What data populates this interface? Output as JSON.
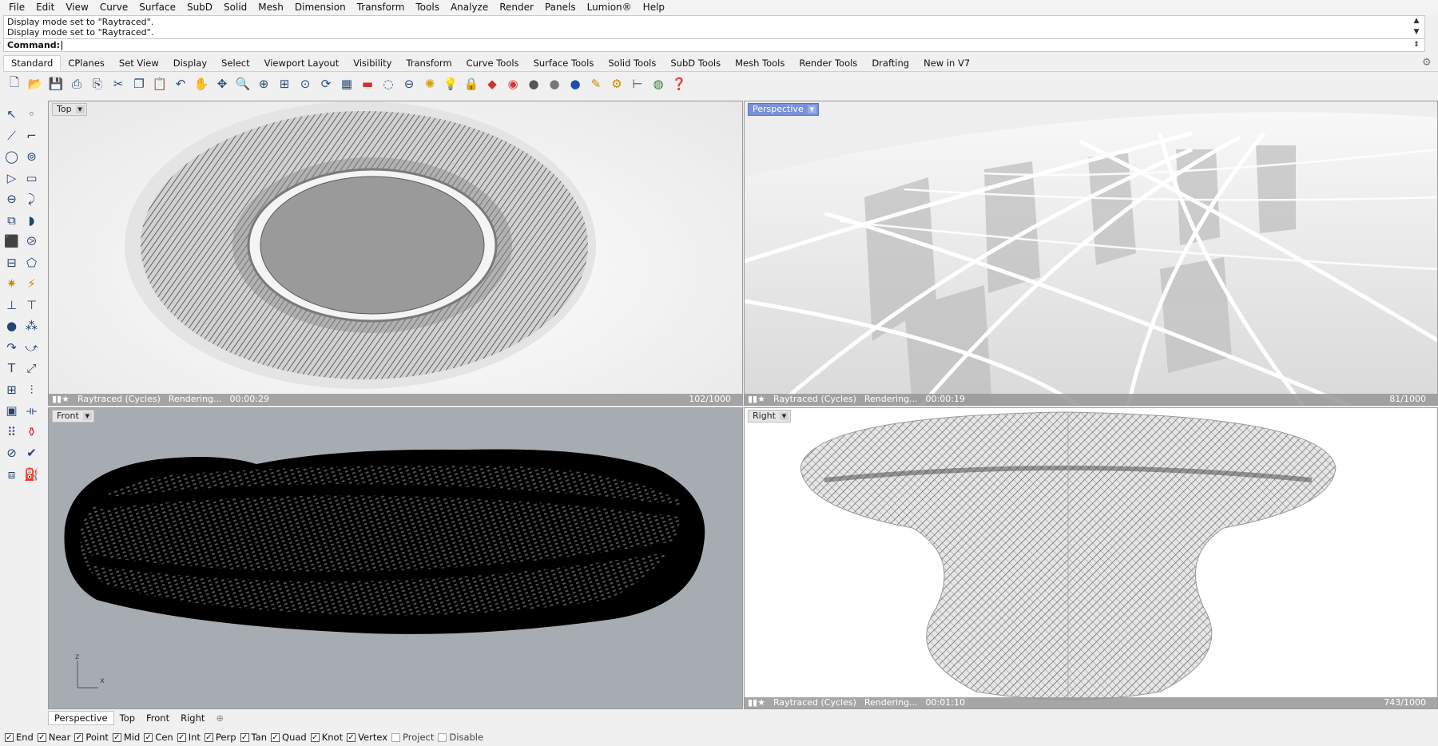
{
  "menu": [
    "File",
    "Edit",
    "View",
    "Curve",
    "Surface",
    "SubD",
    "Solid",
    "Mesh",
    "Dimension",
    "Transform",
    "Tools",
    "Analyze",
    "Render",
    "Panels",
    "Lumion®",
    "Help"
  ],
  "history": [
    "Display mode set to \"Raytraced\".",
    "Display mode set to \"Raytraced\"."
  ],
  "command": {
    "label": "Command:"
  },
  "tabs": [
    {
      "label": "Standard",
      "active": true
    },
    {
      "label": "CPlanes"
    },
    {
      "label": "Set View"
    },
    {
      "label": "Display"
    },
    {
      "label": "Select"
    },
    {
      "label": "Viewport Layout"
    },
    {
      "label": "Visibility"
    },
    {
      "label": "Transform"
    },
    {
      "label": "Curve Tools"
    },
    {
      "label": "Surface Tools"
    },
    {
      "label": "Solid Tools"
    },
    {
      "label": "SubD Tools"
    },
    {
      "label": "Mesh Tools"
    },
    {
      "label": "Render Tools"
    },
    {
      "label": "Drafting"
    },
    {
      "label": "New in V7"
    }
  ],
  "toolbar_icons": [
    "new-file",
    "open-folder",
    "save",
    "print",
    "import",
    "cut",
    "copy",
    "paste",
    "undo",
    "pan",
    "rotate-view",
    "zoom",
    "zoom-window",
    "zoom-extents",
    "zoom-selected",
    "regen",
    "grid",
    "car-model",
    "render-preview",
    "world-axes",
    "snap",
    "lightbulb",
    "lock",
    "layer",
    "color-wheel",
    "sphere-shaded",
    "sphere-rendered",
    "sphere-blue",
    "pencil",
    "gears",
    "grid-dimension",
    "earth",
    "help"
  ],
  "left_tools": [
    [
      "select-arrow",
      "point"
    ],
    [
      "polyline",
      "curve-cp"
    ],
    [
      "circle",
      "ellipse"
    ],
    [
      "polygon",
      "rectangle"
    ],
    [
      "arc",
      "fillet-curve"
    ],
    [
      "surface-edit",
      "surface-loft"
    ],
    [
      "box",
      "boolean"
    ],
    [
      "extrude",
      "plane"
    ],
    [
      "explode",
      "blend"
    ],
    [
      "array",
      "mirror"
    ],
    [
      "sphere-fill",
      "cluster"
    ],
    [
      "rotate",
      "move-arc"
    ],
    [
      "text",
      "dimension"
    ],
    [
      "group",
      "align"
    ],
    [
      "block",
      "gumball"
    ],
    [
      "grid-array",
      "cage"
    ],
    [
      "curvature",
      "check"
    ],
    [
      "mesh",
      "paint"
    ]
  ],
  "viewports": {
    "top": {
      "label": "Top",
      "mode": "Raytraced (Cycles)",
      "state": "Rendering...",
      "time": "00:00:29",
      "passes": "102/1000"
    },
    "perspective": {
      "label": "Perspective",
      "mode": "Raytraced (Cycles)",
      "state": "Rendering...",
      "time": "00:00:19",
      "passes": "81/1000"
    },
    "front": {
      "label": "Front"
    },
    "right": {
      "label": "Right",
      "mode": "Raytraced (Cycles)",
      "state": "Rendering...",
      "time": "00:01:10",
      "passes": "743/1000"
    }
  },
  "axis": {
    "z": "z",
    "x": "x"
  },
  "viewport_tabs": [
    {
      "label": "Perspective",
      "active": true
    },
    {
      "label": "Top"
    },
    {
      "label": "Front"
    },
    {
      "label": "Right"
    }
  ],
  "osnaps": [
    {
      "label": "End",
      "checked": true
    },
    {
      "label": "Near",
      "checked": true
    },
    {
      "label": "Point",
      "checked": true
    },
    {
      "label": "Mid",
      "checked": true
    },
    {
      "label": "Cen",
      "checked": true
    },
    {
      "label": "Int",
      "checked": true
    },
    {
      "label": "Perp",
      "checked": true
    },
    {
      "label": "Tan",
      "checked": true
    },
    {
      "label": "Quad",
      "checked": true
    },
    {
      "label": "Knot",
      "checked": true
    },
    {
      "label": "Vertex",
      "checked": true
    },
    {
      "label": "Project",
      "checked": false
    },
    {
      "label": "Disable",
      "checked": false
    }
  ],
  "colors": {
    "selected_viewport": "#7a90d9",
    "front_bg": "#a7acb3"
  }
}
